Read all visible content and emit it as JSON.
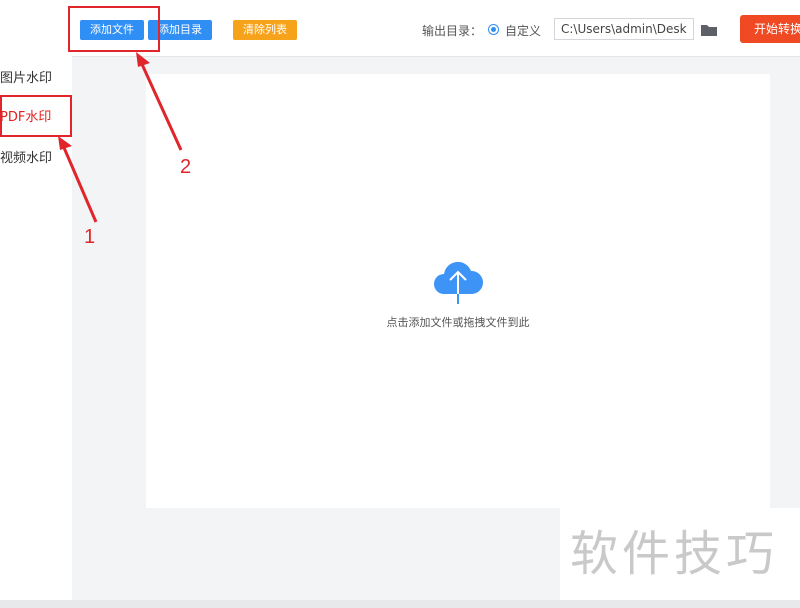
{
  "sidebar": {
    "items": [
      {
        "label": "图片水印",
        "active": false
      },
      {
        "label": "PDF水印",
        "active": true
      },
      {
        "label": "视频水印",
        "active": false
      }
    ]
  },
  "toolbar": {
    "add_file": "添加文件",
    "add_dir": "添加目录",
    "clear_list": "清除列表",
    "output_label": "输出目录：",
    "custom_label": "自定义",
    "output_path": "C:\\Users\\admin\\Deskto",
    "start_button": "开始转换"
  },
  "drop_area": {
    "hint": "点击添加文件或拖拽文件到此"
  },
  "annotations": {
    "num1": "1",
    "num2": "2"
  },
  "watermark": "软件技巧",
  "colors": {
    "primary": "#2f8ff5",
    "accent_orange": "#f7a21b",
    "start_red": "#f04a25",
    "annotation_red": "#e0252b"
  }
}
